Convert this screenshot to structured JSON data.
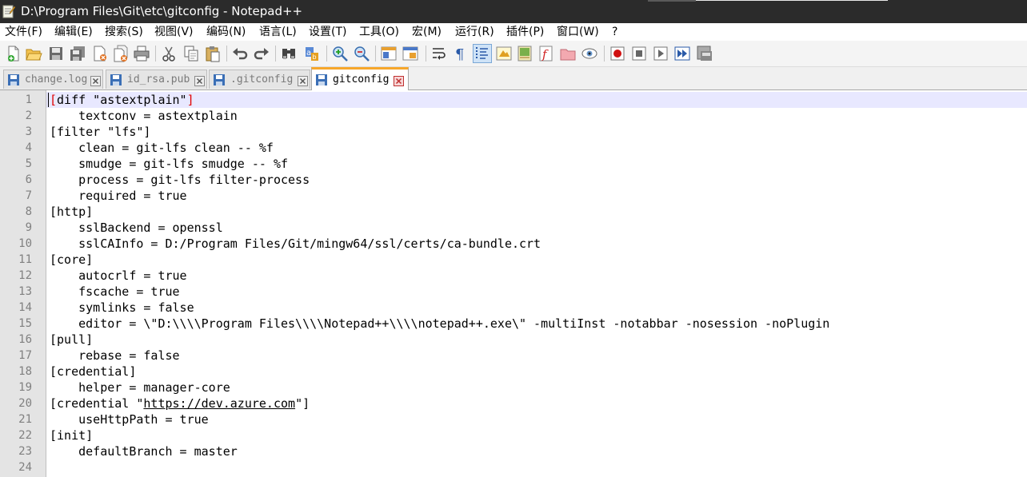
{
  "window": {
    "title": "D:\\Program Files\\Git\\etc\\gitconfig - Notepad++"
  },
  "menu": [
    {
      "id": "file",
      "label": "文件(F)"
    },
    {
      "id": "edit",
      "label": "编辑(E)"
    },
    {
      "id": "search",
      "label": "搜索(S)"
    },
    {
      "id": "view",
      "label": "视图(V)"
    },
    {
      "id": "encoding",
      "label": "编码(N)"
    },
    {
      "id": "language",
      "label": "语言(L)"
    },
    {
      "id": "settings",
      "label": "设置(T)"
    },
    {
      "id": "tools",
      "label": "工具(O)"
    },
    {
      "id": "macro",
      "label": "宏(M)"
    },
    {
      "id": "run",
      "label": "运行(R)"
    },
    {
      "id": "plugins",
      "label": "插件(P)"
    },
    {
      "id": "window",
      "label": "窗口(W)"
    },
    {
      "id": "help",
      "label": "?"
    }
  ],
  "toolbar": [
    {
      "icon": "new-file-icon"
    },
    {
      "icon": "open-file-icon"
    },
    {
      "icon": "save-icon"
    },
    {
      "icon": "save-all-icon"
    },
    {
      "icon": "close-file-icon"
    },
    {
      "icon": "close-all-icon"
    },
    {
      "icon": "print-icon"
    },
    {
      "icon": "cut-icon"
    },
    {
      "icon": "copy-icon"
    },
    {
      "icon": "paste-icon"
    },
    {
      "icon": "undo-icon"
    },
    {
      "icon": "redo-icon"
    },
    {
      "icon": "find-icon"
    },
    {
      "icon": "replace-icon"
    },
    {
      "icon": "zoom-in-icon"
    },
    {
      "icon": "zoom-out-icon"
    },
    {
      "icon": "sync-vertical-scroll-icon"
    },
    {
      "icon": "sync-horizontal-scroll-icon"
    },
    {
      "icon": "word-wrap-icon"
    },
    {
      "icon": "show-all-characters-icon"
    },
    {
      "icon": "indent-guide-icon",
      "pressed": true
    },
    {
      "icon": "user-defined-language-icon"
    },
    {
      "icon": "document-map-icon"
    },
    {
      "icon": "function-list-icon"
    },
    {
      "icon": "folder-as-workspace-icon"
    },
    {
      "icon": "monitoring-icon"
    },
    {
      "icon": "record-macro-icon"
    },
    {
      "icon": "stop-recording-icon"
    },
    {
      "icon": "playback-macro-icon"
    },
    {
      "icon": "run-macro-multiple-icon"
    },
    {
      "icon": "save-macro-icon"
    }
  ],
  "tabs": [
    {
      "label": "change.log",
      "active": false
    },
    {
      "label": "id_rsa.pub",
      "active": false
    },
    {
      "label": ".gitconfig",
      "active": false
    },
    {
      "label": "gitconfig",
      "active": true
    }
  ],
  "editor": {
    "current_line": 1,
    "lines": [
      "[diff \"astextplain\"]",
      "    textconv = astextplain",
      "[filter \"lfs\"]",
      "    clean = git-lfs clean -- %f",
      "    smudge = git-lfs smudge -- %f",
      "    process = git-lfs filter-process",
      "    required = true",
      "[http]",
      "    sslBackend = openssl",
      "    sslCAInfo = D:/Program Files/Git/mingw64/ssl/certs/ca-bundle.crt",
      "[core]",
      "    autocrlf = true",
      "    fscache = true",
      "    symlinks = false",
      "    editor = \\\"D:\\\\\\\\Program Files\\\\\\\\Notepad++\\\\\\\\notepad++.exe\\\" -multiInst -notabbar -nosession -noPlugin",
      "[pull]",
      "    rebase = false",
      "[credential]",
      "    helper = manager-core",
      "[credential \"https://dev.azure.com\"]",
      "    useHttpPath = true",
      "[init]",
      "    defaultBranch = master",
      ""
    ],
    "link_text": "https://dev.azure.com"
  },
  "colors": {
    "titlebar_bg": "#2b2b2b",
    "active_tab_accent": "#f7a72b",
    "gutter_bg": "#e4e4e4",
    "line_number": "#808080",
    "current_line_bg": "#e8e8ff",
    "brace_highlight": "#e00000"
  }
}
